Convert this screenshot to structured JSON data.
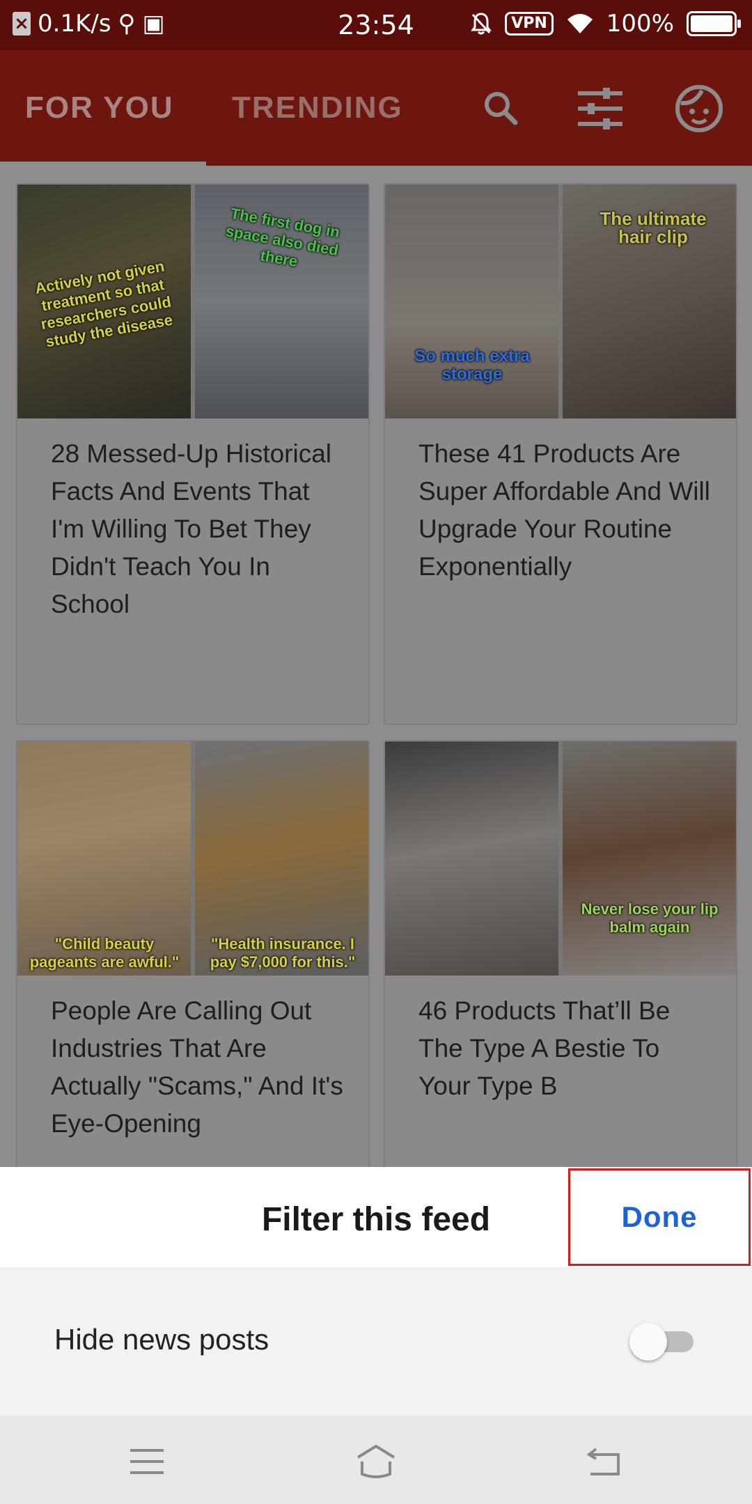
{
  "status_bar": {
    "net_speed": "0.1K/s",
    "time": "23:54",
    "vpn": "VPN",
    "battery": "100%"
  },
  "tabs": [
    {
      "label": "FOR YOU",
      "active": true
    },
    {
      "label": "TRENDING",
      "active": false
    }
  ],
  "icons": {
    "search": "search-icon",
    "filter": "sliders-icon",
    "profile": "face-icon"
  },
  "cards": [
    {
      "title": "28 Messed-Up Historical Facts And Events That I'm Willing To Bet They Didn't Teach You In School",
      "overlay_left": "Actively not given treatment so that researchers could study the disease",
      "overlay_right": "The first dog in space also died there"
    },
    {
      "title": "These 41 Products Are Super Affordable And Will Upgrade Your Routine Exponentially",
      "overlay_left": "So much extra storage",
      "overlay_right": "The ultimate hair clip"
    },
    {
      "title": "People Are Calling Out Industries That Are Actually \"Scams,\" And It's Eye-Opening",
      "overlay_left": "\"Child beauty pageants are awful.\"",
      "overlay_right": "\"Health insurance. I pay $7,000 for this.\""
    },
    {
      "title": "46 Products That’ll Be The Type A Bestie To Your Type B",
      "overlay_left": "",
      "overlay_right": "Never lose your lip balm again"
    }
  ],
  "sheet": {
    "title": "Filter this feed",
    "done_label": "Done",
    "toggle_label": "Hide news posts",
    "toggle_on": false
  },
  "colors": {
    "accent": "#1d63d8",
    "brand_dimmed": "#6d1610",
    "highlight": "#e01818"
  }
}
